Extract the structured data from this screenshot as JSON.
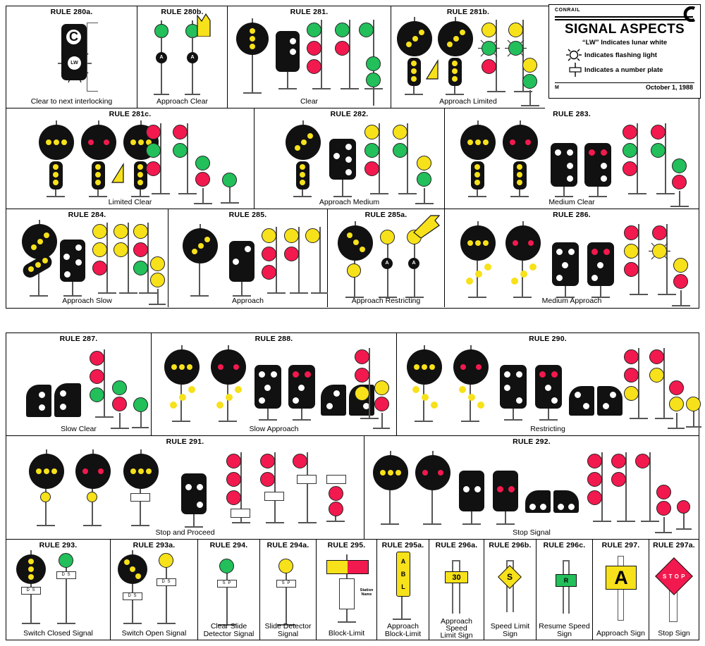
{
  "document": {
    "title": "SIGNAL ASPECTS",
    "railroad": "CONRAIL",
    "note_lw": "“LW” Indicates lunar white",
    "note_flashing": "Indicates flashing light",
    "note_numberplate": "Indicates a number plate",
    "form_code": "M",
    "date": "October 1, 1988"
  },
  "colors": {
    "green": "#22bf5b",
    "red": "#f2194e",
    "yellow": "#f7e11a",
    "white": "#ffffff",
    "black": "#111111",
    "mast": "#555555"
  },
  "section_one": {
    "row1": [
      {
        "rule": "RULE 280a.",
        "caption": "Clear to next interlocking",
        "marker_letters": [
          "C",
          "LW"
        ]
      },
      {
        "rule": "RULE 280b.",
        "caption": "Approach Clear",
        "plate_letter": "A"
      },
      {
        "rule": "RULE 281.",
        "caption": "Clear"
      },
      {
        "rule": "RULE 281b.",
        "caption": "Approach Limited"
      }
    ],
    "row2": [
      {
        "rule": "RULE 281c.",
        "caption": "Limited Clear"
      },
      {
        "rule": "RULE 282.",
        "caption": "Approach Medium"
      },
      {
        "rule": "RULE 283.",
        "caption": "Medium Clear"
      }
    ],
    "row3": [
      {
        "rule": "RULE 284.",
        "caption": "Approach Slow"
      },
      {
        "rule": "RULE 285.",
        "caption": "Approach"
      },
      {
        "rule": "RULE 285a.",
        "caption": "Approach Restricting",
        "plate_letter": "A"
      },
      {
        "rule": "RULE 286.",
        "caption": "Medium Approach"
      }
    ]
  },
  "section_two": {
    "row1": [
      {
        "rule": "RULE 287.",
        "caption": "Slow Clear"
      },
      {
        "rule": "RULE 288.",
        "caption": "Slow Approach"
      },
      {
        "rule": "RULE 290.",
        "caption": "Restricting"
      }
    ],
    "row2": [
      {
        "rule": "RULE 291.",
        "caption": "Stop and Proceed"
      },
      {
        "rule": "RULE 292.",
        "caption": "Stop Signal"
      }
    ],
    "row3": [
      {
        "rule": "RULE 293.",
        "caption": "Switch Closed Signal",
        "plate_text": "D S"
      },
      {
        "rule": "RULE 293a.",
        "caption": "Switch Open Signal",
        "plate_text": "D S"
      },
      {
        "rule": "RULE 294.",
        "caption": "Clear Slide\nDetector Signal",
        "caption_l1": "Clear Slide",
        "caption_l2": "Detector Signal",
        "plate_text": "S P"
      },
      {
        "rule": "RULE 294a.",
        "caption_l1": "Slide Detector",
        "caption_l2": "Signal",
        "plate_text": "S P"
      },
      {
        "rule": "RULE 295.",
        "caption": "Block-Limit",
        "station_l1": "Station",
        "station_l2": "Name"
      },
      {
        "rule": "RULE 295a.",
        "caption_l1": "Approach",
        "caption_l2": "Block-Limit",
        "sign_letters": [
          "A",
          "B",
          "L"
        ]
      },
      {
        "rule": "RULE 296a.",
        "caption_l1": "Approach",
        "caption_l2": "Speed",
        "caption_l3": "Limit Sign",
        "sign_text": "30"
      },
      {
        "rule": "RULE 296b.",
        "caption_l1": "Speed Limit",
        "caption_l2": "Sign",
        "sign_text": "S"
      },
      {
        "rule": "RULE 296c.",
        "caption_l1": "Resume Speed",
        "caption_l2": "Sign",
        "sign_text": "R"
      },
      {
        "rule": "RULE 297.",
        "caption": "Approach Sign",
        "sign_text": "A"
      },
      {
        "rule": "RULE 297a.",
        "caption": "Stop Sign",
        "sign_text": "S T O P"
      }
    ]
  }
}
